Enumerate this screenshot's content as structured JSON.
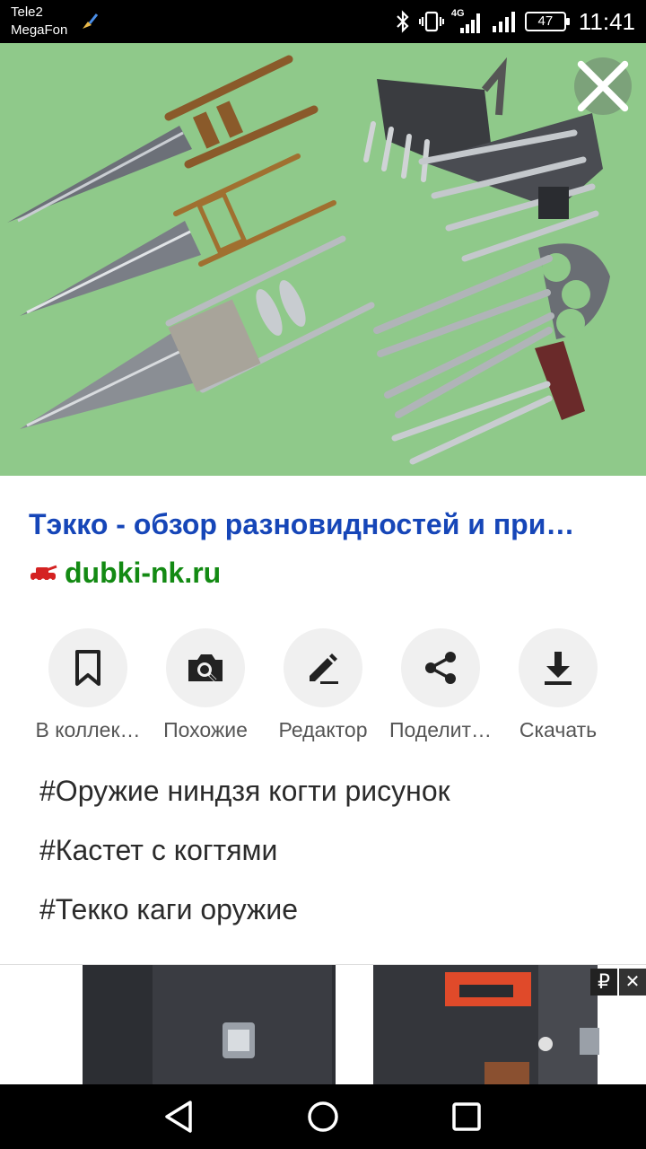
{
  "status_bar": {
    "carrier_1": "Tele2",
    "carrier_2": "MegaFon",
    "network": "4G",
    "battery": "47",
    "time": "11:41"
  },
  "result": {
    "title": "Тэкко - обзор разновидностей и при…",
    "source": "dubki-nk.ru"
  },
  "actions": [
    {
      "label": "В коллек…",
      "icon": "bookmark-icon"
    },
    {
      "label": "Похожие",
      "icon": "camera-search-icon"
    },
    {
      "label": "Редактор",
      "icon": "pencil-icon"
    },
    {
      "label": "Поделит…",
      "icon": "share-icon"
    },
    {
      "label": "Скачать",
      "icon": "download-icon"
    }
  ],
  "tags": [
    "#Оружие ниндзя когти рисунок",
    "#Кастет с когтями",
    "#Текко каги оружие"
  ],
  "ad": {
    "badge": "₽",
    "close": "✕"
  },
  "colors": {
    "title": "#1646b8",
    "source": "#138a13",
    "image_bg": "#8fc98a"
  }
}
